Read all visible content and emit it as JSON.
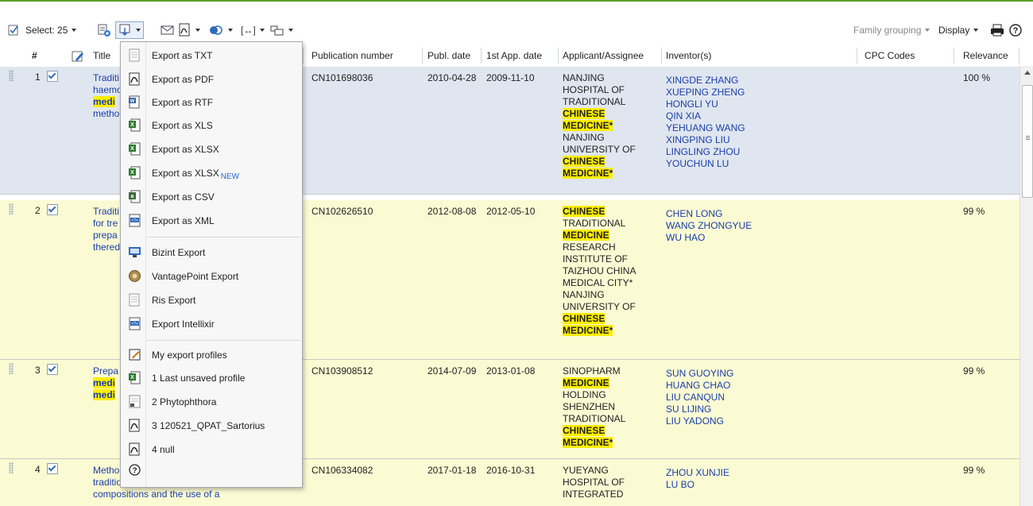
{
  "toolbar": {
    "select_label": "Select: 25",
    "family_grouping": "Family grouping",
    "display": "Display"
  },
  "columns": {
    "num": "#",
    "title": "Title",
    "pubnum": "Publication number",
    "publdate": "Publ. date",
    "appdate": "1st App. date",
    "applicant": "Applicant/Assignee",
    "inventors": "Inventor(s)",
    "cpc": "CPC Codes",
    "relevance": "Relevance"
  },
  "rows": [
    {
      "num": "1",
      "title_lines": [
        "Traditi",
        "haemo",
        "medi",
        "metho"
      ],
      "pubnum": "CN101698036",
      "publdate": "2010-04-28",
      "appdate": "2009-11-10",
      "applicant": [
        "NANJING",
        "HOSPITAL OF",
        "TRADITIONAL",
        "CHINESE",
        "MEDICINE*",
        "NANJING",
        "UNIVERSITY OF",
        "CHINESE",
        "MEDICINE*"
      ],
      "inventors": [
        "XINGDE ZHANG",
        "XUEPING ZHENG",
        "HONGLI YU",
        "QIN XIA",
        "YEHUANG WANG",
        "XINGPING LIU",
        "LINGLING ZHOU",
        "YOUCHUN LU"
      ],
      "relevance": "100 %"
    },
    {
      "num": "2",
      "title_lines": [
        "Traditi",
        "for tre",
        "prepa",
        "thered"
      ],
      "pubnum": "CN102626510",
      "publdate": "2012-08-08",
      "appdate": "2012-05-10",
      "applicant": [
        "CHINESE",
        "TRADITIONAL",
        "MEDICINE",
        "RESEARCH",
        "INSTITUTE OF",
        "TAIZHOU CHINA",
        "MEDICAL CITY*",
        "NANJING",
        "UNIVERSITY OF",
        "CHINESE",
        "MEDICINE*"
      ],
      "inventors": [
        "CHEN LONG",
        "WANG ZHONGYUE",
        "WU HAO"
      ],
      "relevance": "99 %"
    },
    {
      "num": "3",
      "title_lines": [
        "Prepa",
        "medi",
        "medi"
      ],
      "pubnum": "CN103908512",
      "publdate": "2014-07-09",
      "appdate": "2013-01-08",
      "applicant": [
        "SINOPHARM",
        "MEDICINE",
        "HOLDING",
        "SHENZHEN",
        "TRADITIONAL",
        "CHINESE",
        "MEDICINE*"
      ],
      "inventors": [
        "SUN GUOYING",
        "HUANG CHAO",
        "LIU CANQUN",
        "SU LIJING",
        "LIU YADONG"
      ],
      "relevance": "99 %"
    },
    {
      "num": "4",
      "title_lines": [
        "Metho",
        "traditional chinese medicine",
        "compositions and the use of a"
      ],
      "pubnum": "CN106334082",
      "publdate": "2017-01-18",
      "appdate": "2016-10-31",
      "applicant": [
        "YUEYANG",
        "HOSPITAL OF",
        "INTEGRATED"
      ],
      "inventors": [
        "ZHOU XUNJIE",
        "LU BO"
      ],
      "relevance": "99 %"
    }
  ],
  "menu": {
    "items": [
      {
        "label": "Export as TXT",
        "icon": "txt-icon"
      },
      {
        "label": "Export as PDF",
        "icon": "pdf-icon"
      },
      {
        "label": "Export as RTF",
        "icon": "rtf-icon"
      },
      {
        "label": "Export as XLS",
        "icon": "xls-icon"
      },
      {
        "label": "Export as XLSX",
        "icon": "xlsx-icon"
      },
      {
        "label": "Export as XLSX",
        "icon": "xlsx-new-icon",
        "tag": "NEW"
      },
      {
        "label": "Export as CSV",
        "icon": "csv-icon"
      },
      {
        "label": "Export as XML",
        "icon": "xml-icon"
      },
      {
        "label": "Bizint Export",
        "icon": "bizint-icon"
      },
      {
        "label": "VantagePoint Export",
        "icon": "vantagepoint-icon"
      },
      {
        "label": "Ris Export",
        "icon": "ris-icon"
      },
      {
        "label": "Export Intellixir",
        "icon": "intellixir-icon"
      },
      {
        "label": "My export profiles",
        "icon": "export-profiles-icon"
      },
      {
        "label": "1 Last unsaved profile",
        "icon": "xls-profile-icon"
      },
      {
        "label": "2 Phytophthora",
        "icon": "document-profile-icon"
      },
      {
        "label": "3 120521_QPAT_Sartorius",
        "icon": "pdf-profile-icon"
      },
      {
        "label": "4 null",
        "icon": "pdf-profile-icon"
      },
      {
        "label": "",
        "icon": "help-icon"
      }
    ]
  },
  "colors": {
    "highlight": "#ffee00",
    "selected_row": "#dfe6ef",
    "row_bg": "#fbfbd3",
    "link": "#1a3dab",
    "accent": "#5aa02c"
  }
}
